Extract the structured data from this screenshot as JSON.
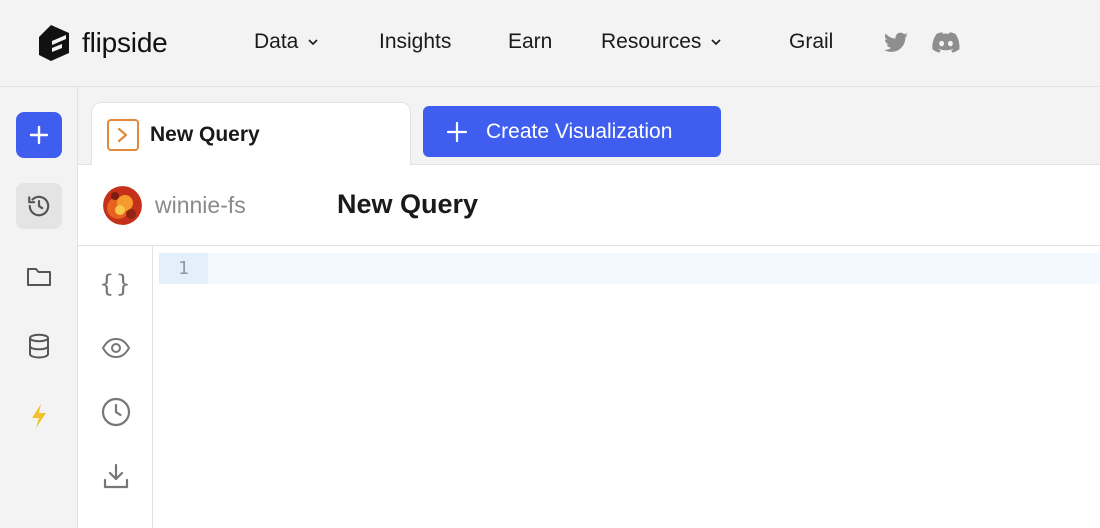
{
  "brand": {
    "name": "flipside"
  },
  "nav": {
    "items": [
      {
        "label": "Data",
        "has_dropdown": true
      },
      {
        "label": "Insights",
        "has_dropdown": false
      },
      {
        "label": "Earn",
        "has_dropdown": false
      },
      {
        "label": "Resources",
        "has_dropdown": true
      },
      {
        "label": "Grail",
        "has_dropdown": false
      }
    ],
    "social": [
      "twitter-icon",
      "discord-icon"
    ]
  },
  "sidebar": {
    "buttons": [
      "plus-icon",
      "history-icon",
      "folder-icon",
      "database-icon",
      "lightning-icon"
    ]
  },
  "tabs": [
    {
      "label": "New Query",
      "icon": "terminal-icon",
      "active": true
    }
  ],
  "toolbar": {
    "create_visualization_label": "Create Visualization"
  },
  "query": {
    "owner": "winnie-fs",
    "title": "New Query"
  },
  "editor": {
    "line_numbers": [
      "1"
    ],
    "content": ""
  },
  "tool_rail": [
    "braces-icon",
    "eye-icon",
    "clock-icon",
    "download-icon"
  ],
  "colors": {
    "accent": "#3f5ef0",
    "tab_icon": "#e08a3c",
    "lightning": "#f2c12e",
    "chrome_bg": "#f3f3f3",
    "editor_line_highlight": "#f3f9fe"
  }
}
